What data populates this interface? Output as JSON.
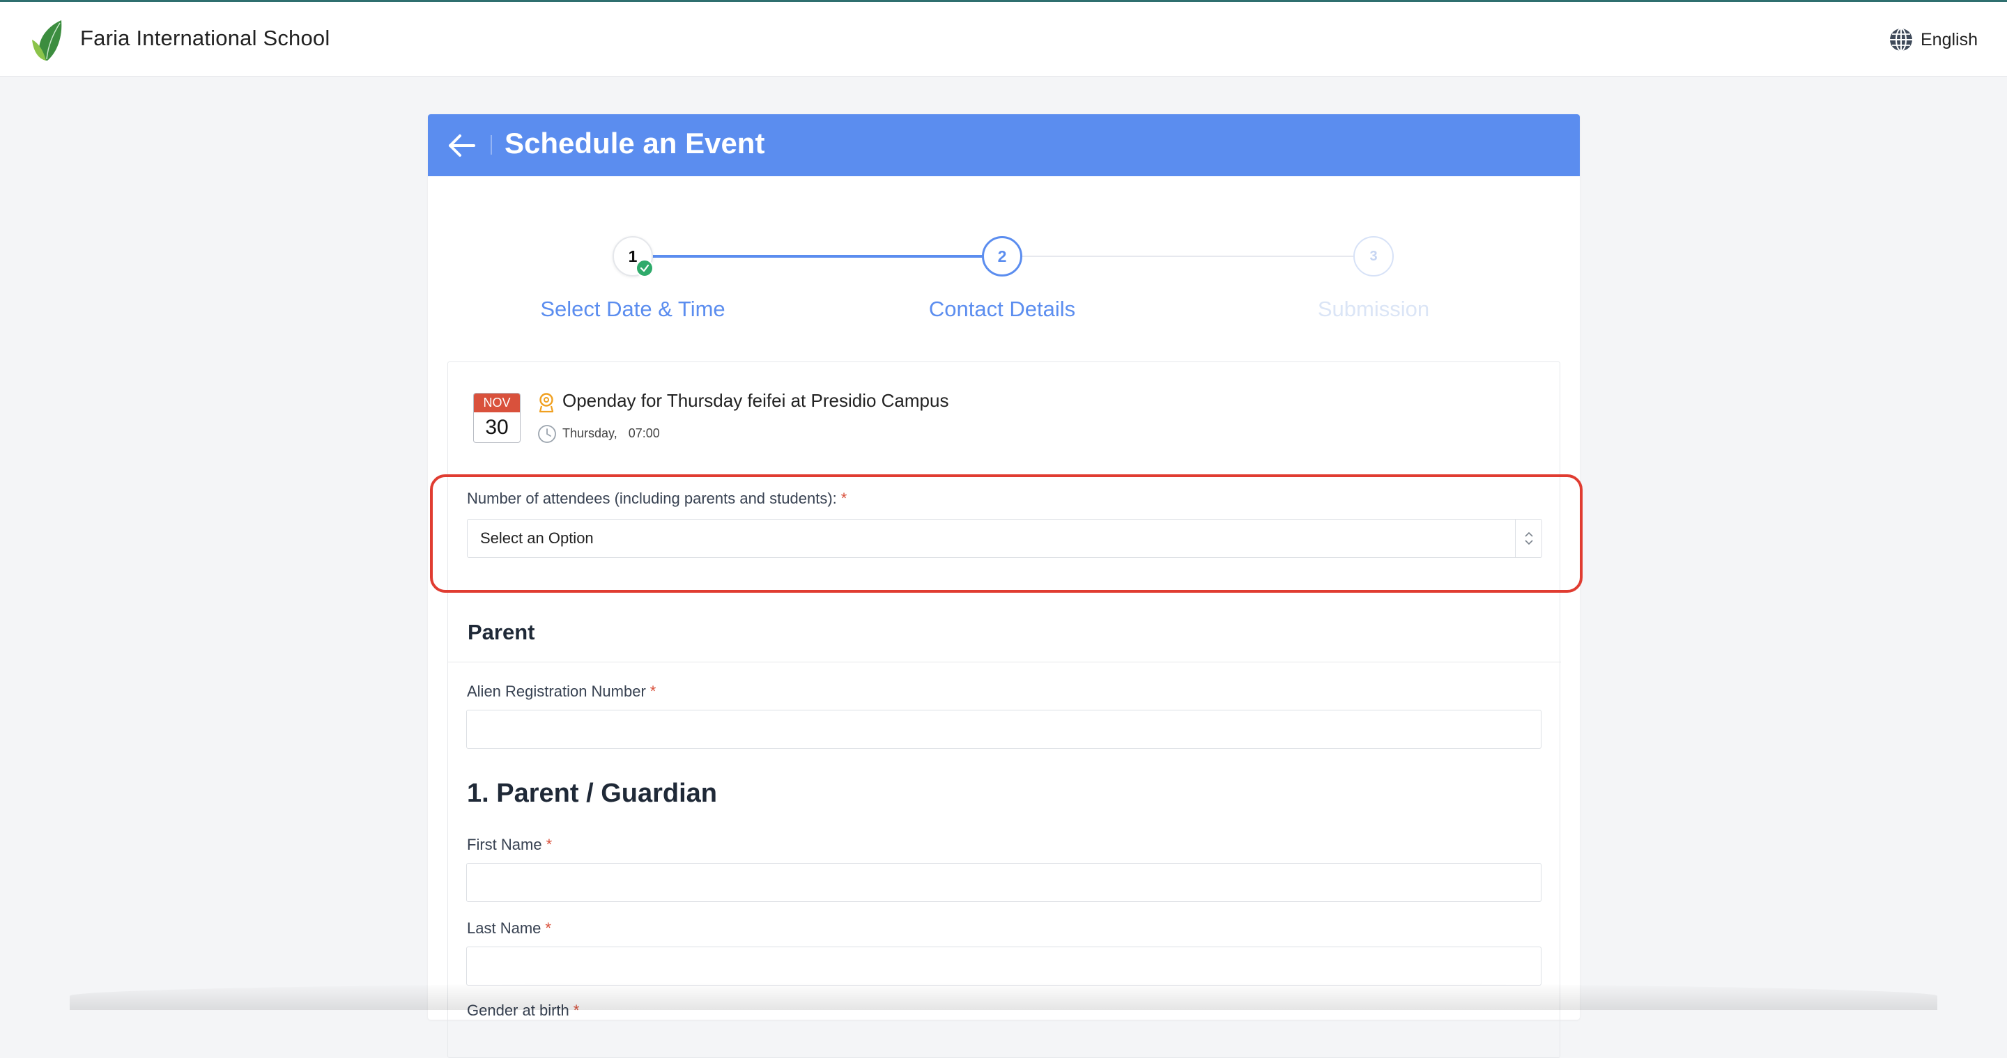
{
  "header": {
    "school_name": "Faria International School",
    "language": "English"
  },
  "card": {
    "title": "Schedule an Event",
    "accent_color": "#5b8def"
  },
  "steps": [
    {
      "number": "1",
      "label": "Select Date & Time",
      "state": "completed"
    },
    {
      "number": "2",
      "label": "Contact Details",
      "state": "active"
    },
    {
      "number": "3",
      "label": "Submission",
      "state": "pending"
    }
  ],
  "event": {
    "month": "NOV",
    "day": "30",
    "title": "Openday for Thursday feifei at Presidio Campus",
    "weekday": "Thursday,",
    "time": "07:00"
  },
  "attendees": {
    "label": "Number of attendees (including parents and students):",
    "required_mark": "*",
    "selected": "Select an Option"
  },
  "parent_section": {
    "title": "Parent",
    "alien_label": "Alien Registration Number",
    "required_mark": "*"
  },
  "guardian_section": {
    "title": "1. Parent / Guardian",
    "first_name_label": "First Name",
    "last_name_label": "Last Name",
    "gender_label": "Gender at birth",
    "required_mark": "*"
  }
}
